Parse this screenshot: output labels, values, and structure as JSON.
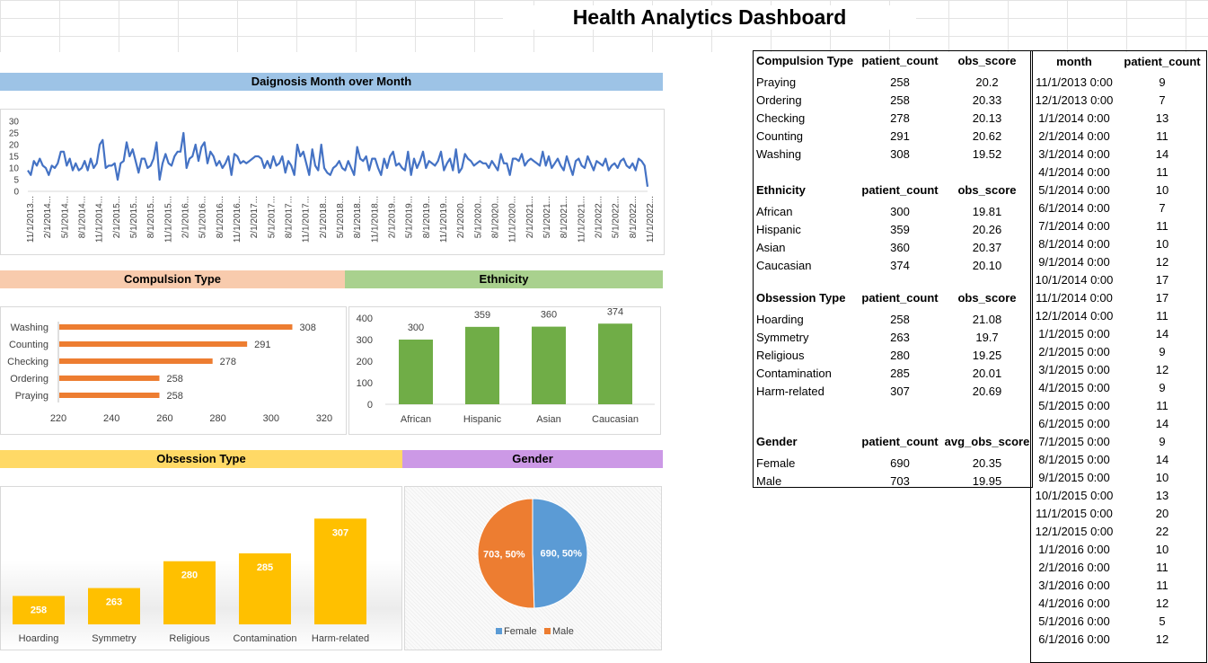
{
  "title": "Health Analytics Dashboard",
  "colors": {
    "line": "#4472c4",
    "compulsion_bar": "#ed7d31",
    "ethnicity_bar": "#70ad47",
    "obsession_bar": "#ffc000",
    "female": "#5b9bd5",
    "male": "#ed7d31",
    "band_blue": "#9dc3e6",
    "band_orange": "#f8cbad",
    "band_green": "#a9d18e",
    "band_yellow": "#ffd966",
    "band_purple": "#cc99e6"
  },
  "bands": {
    "monthly": "Daignosis Month over Month",
    "compulsion": "Compulsion Type",
    "ethnicity": "Ethnicity",
    "obsession": "Obsession Type",
    "gender": "Gender"
  },
  "chart_data": [
    {
      "type": "line",
      "title": "",
      "y_ticks": [
        "30",
        "25",
        "20",
        "15",
        "10",
        "5",
        "0"
      ],
      "ylim": [
        0,
        30
      ],
      "x_tick_labels": [
        "11/1/2013...",
        "2/1/2014...",
        "5/1/2014...",
        "8/1/2014...",
        "11/1/2014...",
        "2/1/2015...",
        "5/1/2015...",
        "8/1/2015...",
        "11/1/2015...",
        "2/1/2016...",
        "5/1/2016...",
        "8/1/2016...",
        "11/1/2016...",
        "2/1/2017...",
        "5/1/2017...",
        "8/1/2017...",
        "11/1/2017...",
        "2/1/2018...",
        "5/1/2018...",
        "8/1/2018...",
        "11/1/2018...",
        "2/1/2019...",
        "5/1/2019...",
        "8/1/2019...",
        "11/1/2019...",
        "2/1/2020...",
        "5/1/2020...",
        "8/1/2020...",
        "11/1/2020...",
        "2/1/2021...",
        "5/1/2021...",
        "8/1/2021...",
        "11/1/2021...",
        "2/1/2022...",
        "5/1/2022...",
        "8/1/2022...",
        "11/1/2022..."
      ],
      "values": [
        9,
        7,
        13,
        11,
        14,
        11,
        10,
        7,
        11,
        10,
        12,
        17,
        17,
        11,
        14,
        9,
        12,
        9,
        10,
        13,
        9,
        14,
        10,
        12,
        20,
        22,
        10,
        11,
        11,
        12,
        5,
        12,
        13,
        21,
        15,
        18,
        13,
        8,
        14,
        14,
        10,
        11,
        14,
        21,
        5,
        12,
        16,
        12,
        11,
        15,
        17,
        17,
        25,
        10,
        14,
        15,
        20,
        13,
        19,
        21,
        12,
        17,
        15,
        11,
        13,
        10,
        12,
        15,
        7,
        16,
        15,
        12,
        13,
        12,
        13,
        14,
        15,
        15,
        14,
        10,
        13,
        10,
        15,
        11,
        12,
        15,
        8,
        13,
        11,
        7,
        20,
        15,
        17,
        12,
        7,
        18,
        11,
        9,
        20,
        10,
        8,
        7,
        10,
        11,
        13,
        10,
        9,
        13,
        10,
        7,
        19,
        14,
        13,
        15,
        9,
        14,
        14,
        10,
        7,
        14,
        10,
        15,
        17,
        11,
        12,
        10,
        9,
        17,
        7,
        14,
        10,
        13,
        17,
        10,
        13,
        12,
        11,
        13,
        17,
        9,
        12,
        14,
        9,
        18,
        8,
        10,
        16,
        14,
        13,
        11,
        12,
        13,
        12,
        12,
        10,
        13,
        11,
        9,
        16,
        12,
        12,
        7,
        14,
        14,
        13,
        16,
        11,
        13,
        14,
        13,
        12,
        11,
        17,
        11,
        15,
        10,
        12,
        14,
        11,
        9,
        15,
        11,
        7,
        13,
        14,
        11,
        10,
        15,
        12,
        9,
        13,
        12,
        11,
        14,
        9,
        11,
        12,
        10,
        13,
        14,
        11,
        10,
        12,
        9,
        14,
        13,
        11,
        2
      ],
      "note": ""
    },
    {
      "type": "bar",
      "orientation": "horizontal",
      "categories": [
        "Washing",
        "Counting",
        "Checking",
        "Ordering",
        "Praying"
      ],
      "values": [
        308,
        291,
        278,
        258,
        258
      ],
      "x_ticks": [
        "220",
        "240",
        "260",
        "280",
        "300",
        "320"
      ],
      "xlim": [
        220,
        320
      ]
    },
    {
      "type": "bar",
      "categories": [
        "African",
        "Hispanic",
        "Asian",
        "Caucasian"
      ],
      "values": [
        300,
        359,
        360,
        374
      ],
      "y_ticks": [
        "400",
        "300",
        "200",
        "100",
        "0"
      ],
      "ylim": [
        0,
        400
      ]
    },
    {
      "type": "bar",
      "categories": [
        "Hoarding",
        "Symmetry",
        "Religious",
        "Contamination",
        "Harm-related"
      ],
      "values": [
        258,
        263,
        280,
        285,
        307
      ]
    },
    {
      "type": "pie",
      "slices": [
        {
          "name": "Female",
          "value": 690,
          "label": "690, 50%"
        },
        {
          "name": "Male",
          "value": 703,
          "label": "703, 50%"
        }
      ],
      "legend": [
        "Female",
        "Male"
      ]
    }
  ],
  "summary_table": {
    "compulsion": {
      "headers": [
        "Compulsion Type",
        "patient_count",
        "obs_score"
      ],
      "rows": [
        [
          "Praying",
          "258",
          "20.2"
        ],
        [
          "Ordering",
          "258",
          "20.33"
        ],
        [
          "Checking",
          "278",
          "20.13"
        ],
        [
          "Counting",
          "291",
          "20.62"
        ],
        [
          "Washing",
          "308",
          "19.52"
        ]
      ]
    },
    "ethnicity": {
      "headers": [
        "Ethnicity",
        "patient_count",
        "obs_score"
      ],
      "rows": [
        [
          "African",
          "300",
          "19.81"
        ],
        [
          "Hispanic",
          "359",
          "20.26"
        ],
        [
          "Asian",
          "360",
          "20.37"
        ],
        [
          "Caucasian",
          "374",
          "20.10"
        ]
      ]
    },
    "obsession": {
      "headers": [
        "Obsession Type",
        "patient_count",
        "obs_score"
      ],
      "rows": [
        [
          "Hoarding",
          "258",
          "21.08"
        ],
        [
          "Symmetry",
          "263",
          "19.7"
        ],
        [
          "Religious",
          "280",
          "19.25"
        ],
        [
          "Contamination",
          "285",
          "20.01"
        ],
        [
          "Harm-related",
          "307",
          "20.69"
        ]
      ]
    },
    "gender": {
      "headers": [
        "Gender",
        "patient_count",
        "avg_obs_score"
      ],
      "rows": [
        [
          "Female",
          "690",
          "20.35"
        ],
        [
          "Male",
          "703",
          "19.95"
        ]
      ]
    }
  },
  "month_table": {
    "headers": [
      "month",
      "patient_count"
    ],
    "rows": [
      [
        "11/1/2013 0:00",
        "9"
      ],
      [
        "12/1/2013 0:00",
        "7"
      ],
      [
        "1/1/2014 0:00",
        "13"
      ],
      [
        "2/1/2014 0:00",
        "11"
      ],
      [
        "3/1/2014 0:00",
        "14"
      ],
      [
        "4/1/2014 0:00",
        "11"
      ],
      [
        "5/1/2014 0:00",
        "10"
      ],
      [
        "6/1/2014 0:00",
        "7"
      ],
      [
        "7/1/2014 0:00",
        "11"
      ],
      [
        "8/1/2014 0:00",
        "10"
      ],
      [
        "9/1/2014 0:00",
        "12"
      ],
      [
        "10/1/2014 0:00",
        "17"
      ],
      [
        "11/1/2014 0:00",
        "17"
      ],
      [
        "12/1/2014 0:00",
        "11"
      ],
      [
        "1/1/2015 0:00",
        "14"
      ],
      [
        "2/1/2015 0:00",
        "9"
      ],
      [
        "3/1/2015 0:00",
        "12"
      ],
      [
        "4/1/2015 0:00",
        "9"
      ],
      [
        "5/1/2015 0:00",
        "11"
      ],
      [
        "6/1/2015 0:00",
        "14"
      ],
      [
        "7/1/2015 0:00",
        "9"
      ],
      [
        "8/1/2015 0:00",
        "14"
      ],
      [
        "9/1/2015 0:00",
        "10"
      ],
      [
        "10/1/2015 0:00",
        "13"
      ],
      [
        "11/1/2015 0:00",
        "20"
      ],
      [
        "12/1/2015 0:00",
        "22"
      ],
      [
        "1/1/2016 0:00",
        "10"
      ],
      [
        "2/1/2016 0:00",
        "11"
      ],
      [
        "3/1/2016 0:00",
        "11"
      ],
      [
        "4/1/2016 0:00",
        "12"
      ],
      [
        "5/1/2016 0:00",
        "5"
      ],
      [
        "6/1/2016 0:00",
        "12"
      ]
    ]
  }
}
